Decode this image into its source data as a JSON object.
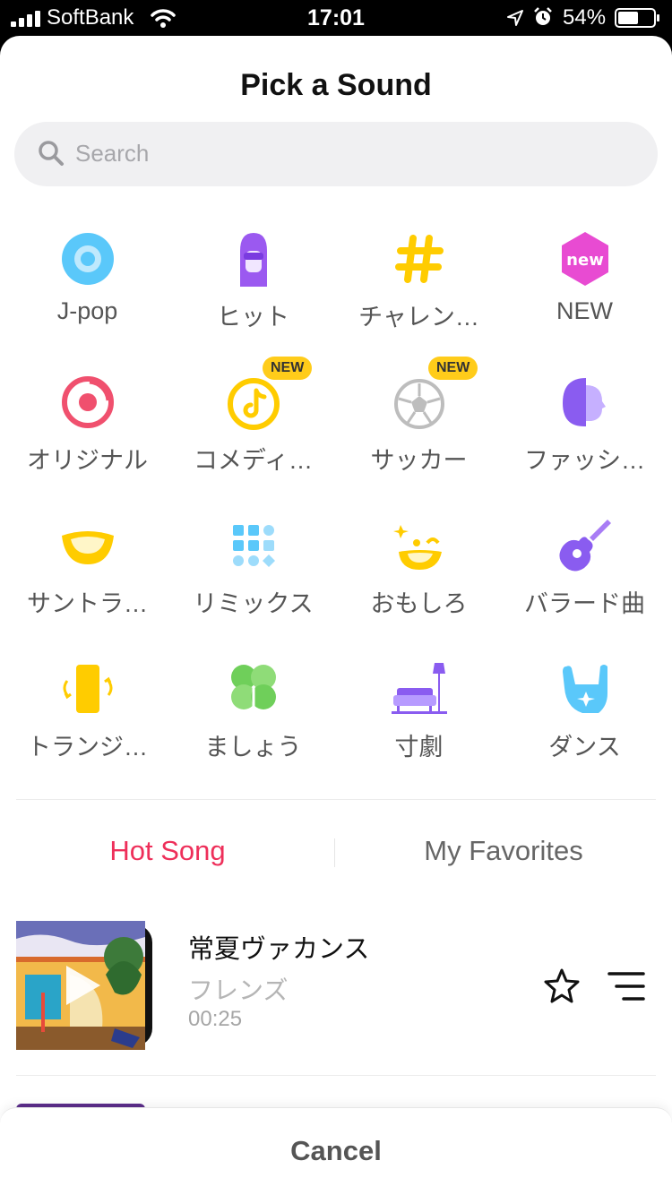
{
  "status_bar": {
    "carrier": "SoftBank",
    "time": "17:01",
    "battery_percent": "54%"
  },
  "sheet": {
    "title": "Pick a Sound",
    "search_placeholder": "Search"
  },
  "categories": [
    {
      "label": "J-pop",
      "icon": "vinyl-disc-icon"
    },
    {
      "label": "ヒット",
      "icon": "singer-sunglasses-icon"
    },
    {
      "label": "チャレン…",
      "icon": "hashtag-icon"
    },
    {
      "label": "NEW",
      "icon": "new-hexagon-icon"
    },
    {
      "label": "オリジナル",
      "icon": "record-original-icon"
    },
    {
      "label": "コメディ…",
      "icon": "tiktok-note-icon",
      "badge": "NEW"
    },
    {
      "label": "サッカー",
      "icon": "soccer-ball-icon",
      "badge": "NEW"
    },
    {
      "label": "ファッシ…",
      "icon": "fashion-profile-icon"
    },
    {
      "label": "サントラ…",
      "icon": "smile-mouth-icon"
    },
    {
      "label": "リミックス",
      "icon": "remix-grid-icon"
    },
    {
      "label": "おもしろ",
      "icon": "funny-face-icon"
    },
    {
      "label": "バラード曲",
      "icon": "guitar-icon"
    },
    {
      "label": "トランジ…",
      "icon": "phone-rotate-icon"
    },
    {
      "label": "ましょう",
      "icon": "clover-icon"
    },
    {
      "label": "寸劇",
      "icon": "sofa-lamp-icon"
    },
    {
      "label": "ダンス",
      "icon": "rock-hand-icon"
    }
  ],
  "tabs": {
    "hot": "Hot Song",
    "favorites": "My Favorites"
  },
  "song": {
    "title": "常夏ヴァカンス",
    "artist": "フレンズ",
    "duration": "00:25"
  },
  "cancel_label": "Cancel",
  "colors": {
    "accent": "#ee2f5a",
    "inactive_tab": "#666666"
  }
}
